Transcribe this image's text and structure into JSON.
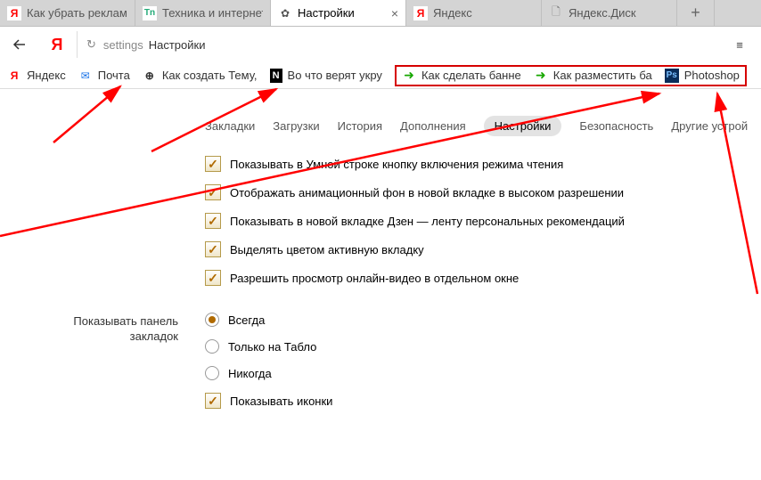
{
  "tabs": [
    {
      "label": "Как убрать реклам"
    },
    {
      "label": "Техника и интернет"
    },
    {
      "label": "Настройки"
    },
    {
      "label": "Яндекс"
    },
    {
      "label": "Яндекс.Диск"
    }
  ],
  "address": {
    "prefix": "settings",
    "text": "Настройки"
  },
  "bookmarks": {
    "items": [
      {
        "label": "Яндекс"
      },
      {
        "label": "Почта"
      },
      {
        "label": "Как создать Тему,"
      },
      {
        "label": "Во что верят укру"
      }
    ],
    "highlighted": [
      {
        "label": "Как сделать банне"
      },
      {
        "label": "Как разместить ба"
      },
      {
        "label": "Photoshop"
      }
    ]
  },
  "section_tabs": {
    "items": [
      "Закладки",
      "Загрузки",
      "История",
      "Дополнения",
      "Настройки",
      "Безопасность",
      "Другие устрой"
    ],
    "active_index": 4
  },
  "options": {
    "checks": [
      "Показывать в Умной строке кнопку включения режима чтения",
      "Отображать анимационный фон в новой вкладке в высоком разрешении",
      "Показывать в новой вкладке Дзен — ленту персональных рекомендаций",
      "Выделять цветом активную вкладку",
      "Разрешить просмотр онлайн-видео в отдельном окне"
    ]
  },
  "bookmarks_panel": {
    "heading_line1": "Показывать панель",
    "heading_line2": "закладок",
    "radios": [
      "Всегда",
      "Только на Табло",
      "Никогда"
    ],
    "radio_selected": 0,
    "show_icons": "Показывать иконки"
  },
  "annotation_color": "#ff0000"
}
